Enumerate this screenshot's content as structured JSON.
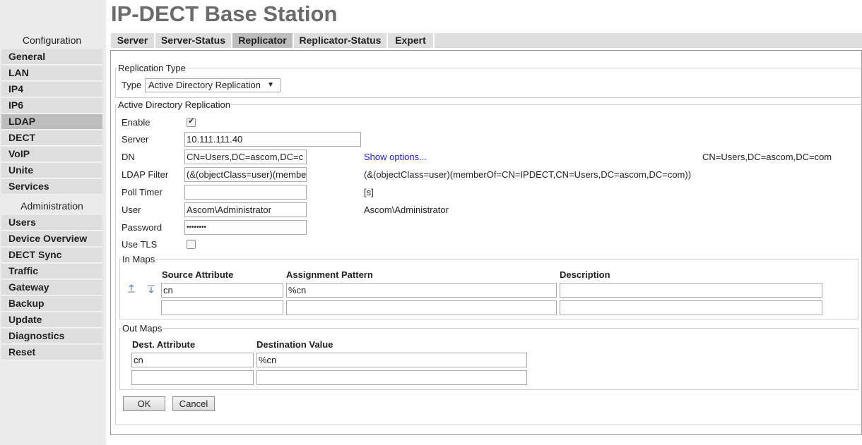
{
  "page": {
    "title": "IP-DECT Base Station"
  },
  "sidebar": {
    "config_heading": "Configuration",
    "config_items": [
      "General",
      "LAN",
      "IP4",
      "IP6",
      "LDAP",
      "DECT",
      "VoIP",
      "Unite",
      "Services"
    ],
    "admin_heading": "Administration",
    "admin_items": [
      "Users",
      "Device Overview",
      "DECT Sync",
      "Traffic",
      "Gateway",
      "Backup",
      "Update",
      "Diagnostics",
      "Reset"
    ],
    "active_item": "LDAP"
  },
  "tabs": [
    "Server",
    "Server-Status",
    "Replicator",
    "Replicator-Status",
    "Expert"
  ],
  "active_tab": "Replicator",
  "replication_type": {
    "legend": "Replication Type",
    "type_label": "Type",
    "type_value": "Active Directory Replication"
  },
  "ad": {
    "legend": "Active Directory Replication",
    "enable_label": "Enable",
    "enable_checked": true,
    "server_label": "Server",
    "server_value": "10.111.111.40",
    "dn_label": "DN",
    "dn_value": "CN=Users,DC=ascom,DC=c",
    "show_options": "Show options...",
    "dn_display": "CN=Users,DC=ascom,DC=com",
    "filter_label": "LDAP Filter",
    "filter_value": "(&(objectClass=user)(membe",
    "filter_display": "(&(objectClass=user)(memberOf=CN=IPDECT,CN=Users,DC=ascom,DC=com))",
    "poll_label": "Poll Timer",
    "poll_value": "",
    "poll_unit": "[s]",
    "user_label": "User",
    "user_value": "Ascom\\Administrator",
    "user_display": "Ascom\\Administrator",
    "password_label": "Password",
    "password_value": "••••••••",
    "tls_label": "Use TLS",
    "tls_checked": false
  },
  "in_maps": {
    "legend": "In Maps",
    "headers": [
      "Source Attribute",
      "Assignment Pattern",
      "Description"
    ],
    "rows": [
      [
        "cn",
        "%cn",
        ""
      ],
      [
        "",
        "",
        ""
      ]
    ]
  },
  "out_maps": {
    "legend": "Out Maps",
    "headers": [
      "Dest. Attribute",
      "Destination Value"
    ],
    "rows": [
      [
        "cn",
        "%cn"
      ],
      [
        "",
        ""
      ]
    ]
  },
  "buttons": {
    "ok": "OK",
    "cancel": "Cancel"
  }
}
